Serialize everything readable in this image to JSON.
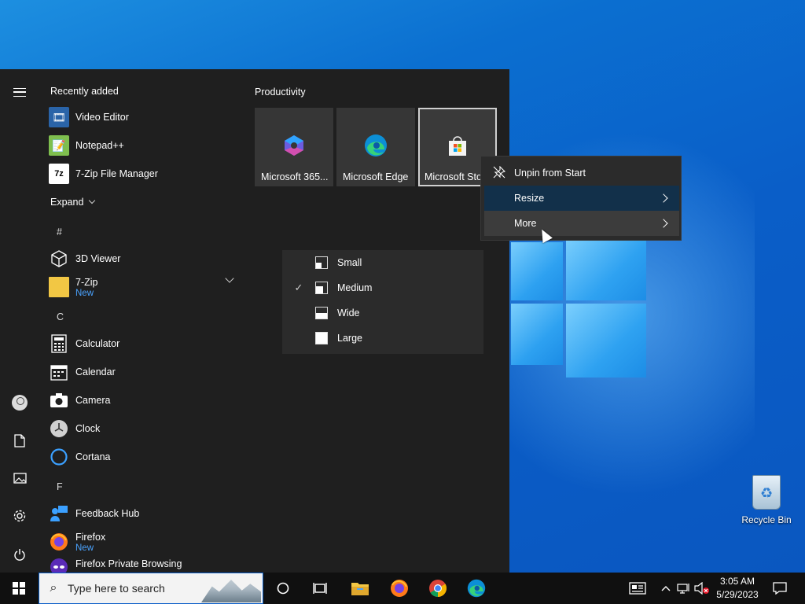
{
  "start_menu": {
    "recently_added_label": "Recently added",
    "expand_label": "Expand",
    "recent_apps": [
      {
        "name": "Video Editor"
      },
      {
        "name": "Notepad++"
      },
      {
        "name": "7-Zip File Manager"
      }
    ],
    "letters": [
      "#",
      "C",
      "F"
    ],
    "apps": [
      {
        "name": "3D Viewer",
        "sub": ""
      },
      {
        "name": "7-Zip",
        "sub": "New"
      },
      {
        "name": "Calculator",
        "sub": ""
      },
      {
        "name": "Calendar",
        "sub": ""
      },
      {
        "name": "Camera",
        "sub": ""
      },
      {
        "name": "Clock",
        "sub": ""
      },
      {
        "name": "Cortana",
        "sub": ""
      },
      {
        "name": "Feedback Hub",
        "sub": ""
      },
      {
        "name": "Firefox",
        "sub": "New"
      },
      {
        "name": "Firefox Private Browsing",
        "sub": ""
      }
    ],
    "group_title": "Productivity",
    "tiles": [
      {
        "label": "Microsoft 365..."
      },
      {
        "label": "Microsoft Edge"
      },
      {
        "label": "Microsoft Store"
      }
    ]
  },
  "resize_menu": {
    "items": [
      {
        "label": "Small",
        "checked": false
      },
      {
        "label": "Medium",
        "checked": true,
        "check_glyph": "✓"
      },
      {
        "label": "Wide",
        "checked": false
      },
      {
        "label": "Large",
        "checked": false
      }
    ]
  },
  "context_menu": {
    "items": [
      {
        "label": "Unpin from Start"
      },
      {
        "label": "Resize"
      },
      {
        "label": "More"
      }
    ]
  },
  "desktop": {
    "recycle_bin_label": "Recycle Bin"
  },
  "taskbar": {
    "search_placeholder": "Type here to search",
    "clock_time": "3:05 AM",
    "clock_date": "5/29/2023"
  },
  "colors": {
    "accent": "#0a5ec8",
    "menu_bg": "#1f1f1f",
    "new_badge": "#4aa3ff"
  }
}
